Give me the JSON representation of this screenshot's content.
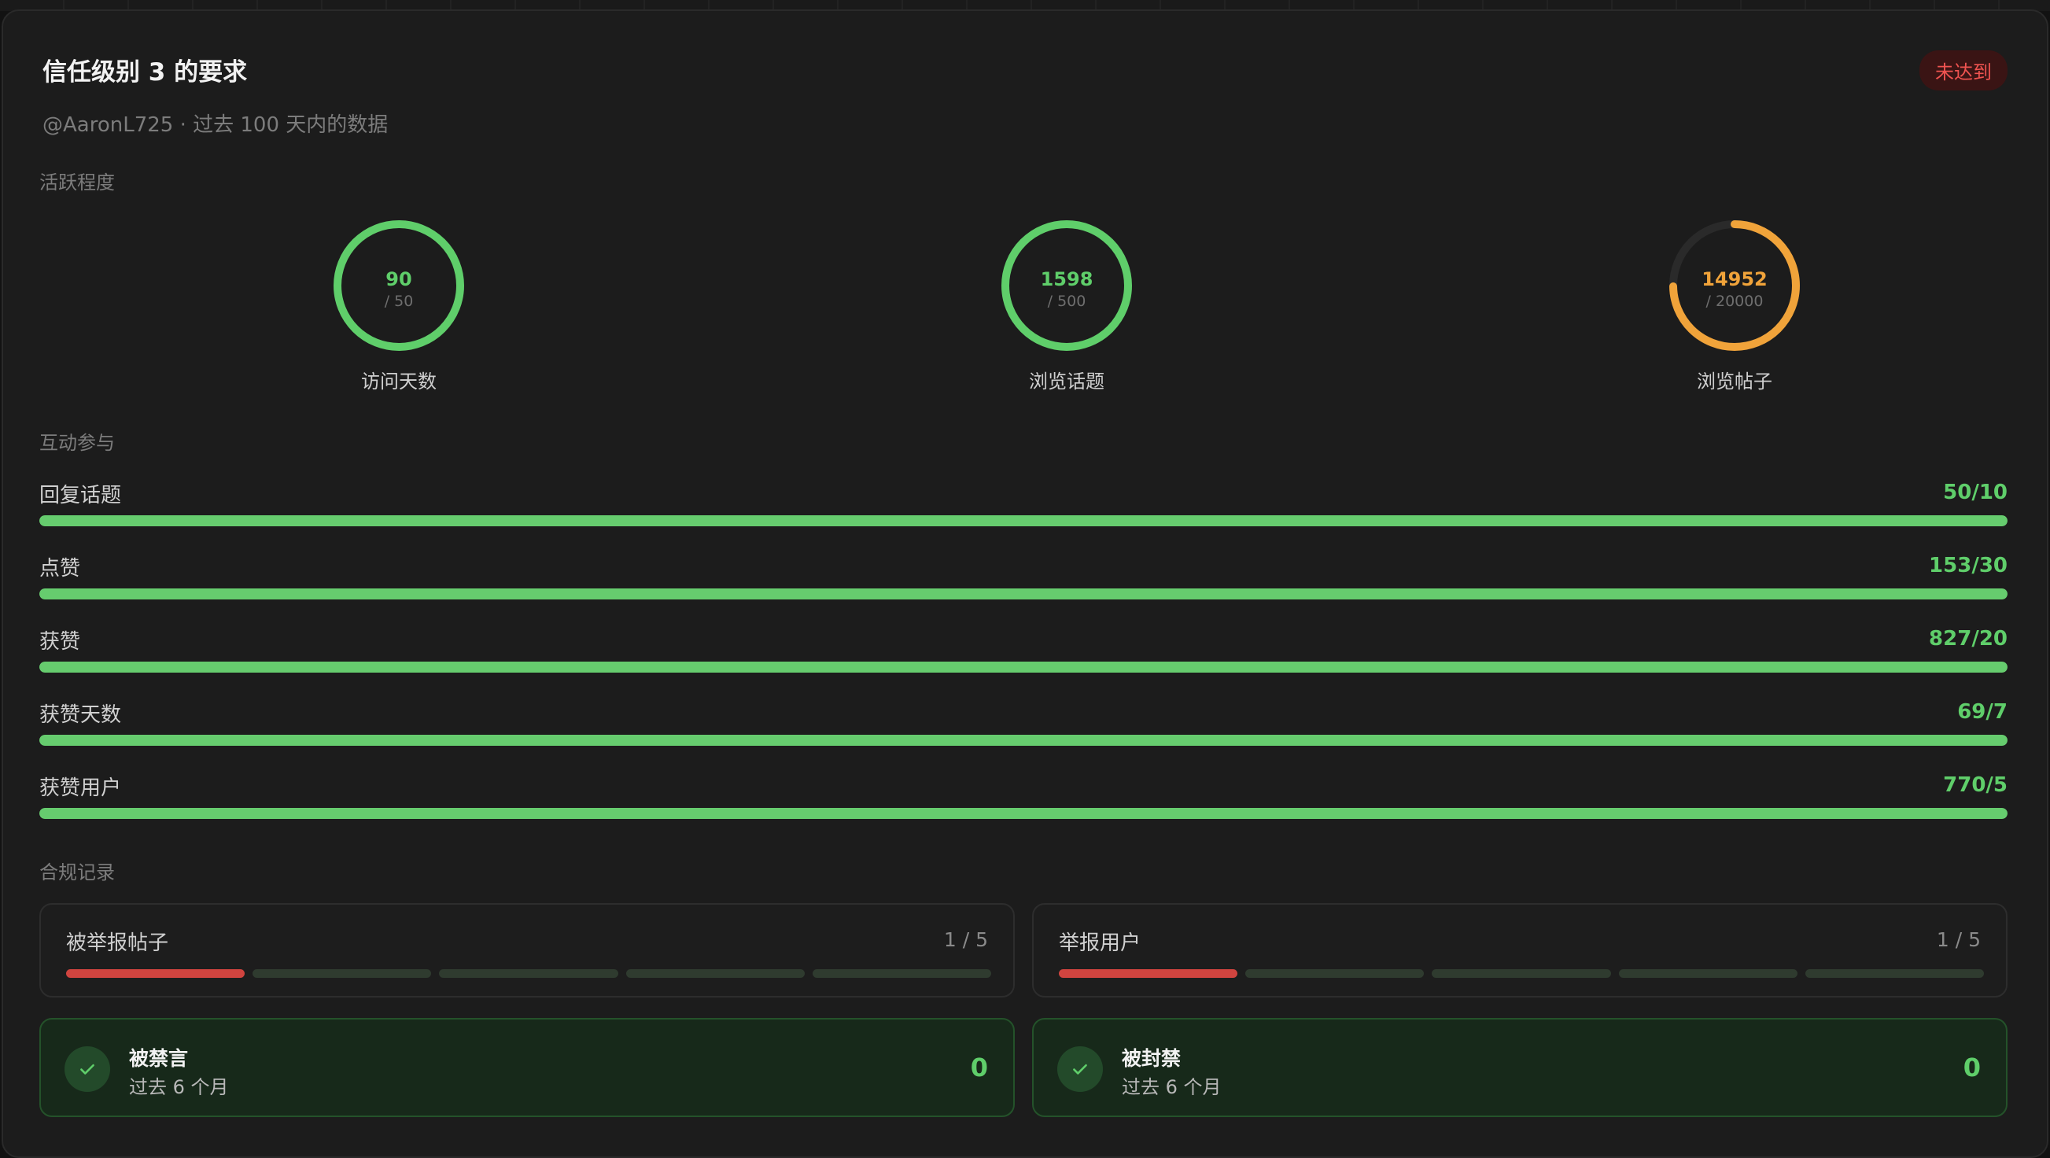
{
  "header": {
    "title": "信任级别 3 的要求",
    "badge": "未达到",
    "subtitle": "@AaronL725 · 过去 100 天内的数据"
  },
  "colors": {
    "ok": "#5fce6a",
    "warn": "#f0a33a",
    "bad": "#d0443f",
    "track": "#2a2a2a"
  },
  "activity": {
    "label": "活跃程度",
    "rings": [
      {
        "value": "90",
        "max": "/ 50",
        "label": "访问天数",
        "progress": 1.0,
        "status": "ok"
      },
      {
        "value": "1598",
        "max": "/ 500",
        "label": "浏览话题",
        "progress": 1.0,
        "status": "ok"
      },
      {
        "value": "14952",
        "max": "/ 20000",
        "label": "浏览帖子",
        "progress": 0.7476,
        "status": "warn"
      }
    ]
  },
  "interaction": {
    "label": "互动参与",
    "bars": [
      {
        "label": "回复话题",
        "value": "50/10",
        "progress": 1.0
      },
      {
        "label": "点赞",
        "value": "153/30",
        "progress": 1.0
      },
      {
        "label": "获赞",
        "value": "827/20",
        "progress": 1.0
      },
      {
        "label": "获赞天数",
        "value": "69/7",
        "progress": 1.0
      },
      {
        "label": "获赞用户",
        "value": "770/5",
        "progress": 1.0
      }
    ]
  },
  "compliance": {
    "label": "合规记录",
    "reports": [
      {
        "label": "被举报帖子",
        "count": "1 / 5",
        "filled": 1,
        "total": 5
      },
      {
        "label": "举报用户",
        "count": "1 / 5",
        "filled": 1,
        "total": 5
      }
    ],
    "bans": [
      {
        "title": "被禁言",
        "sub": "过去 6 个月",
        "value": "0"
      },
      {
        "title": "被封禁",
        "sub": "过去 6 个月",
        "value": "0"
      }
    ]
  }
}
